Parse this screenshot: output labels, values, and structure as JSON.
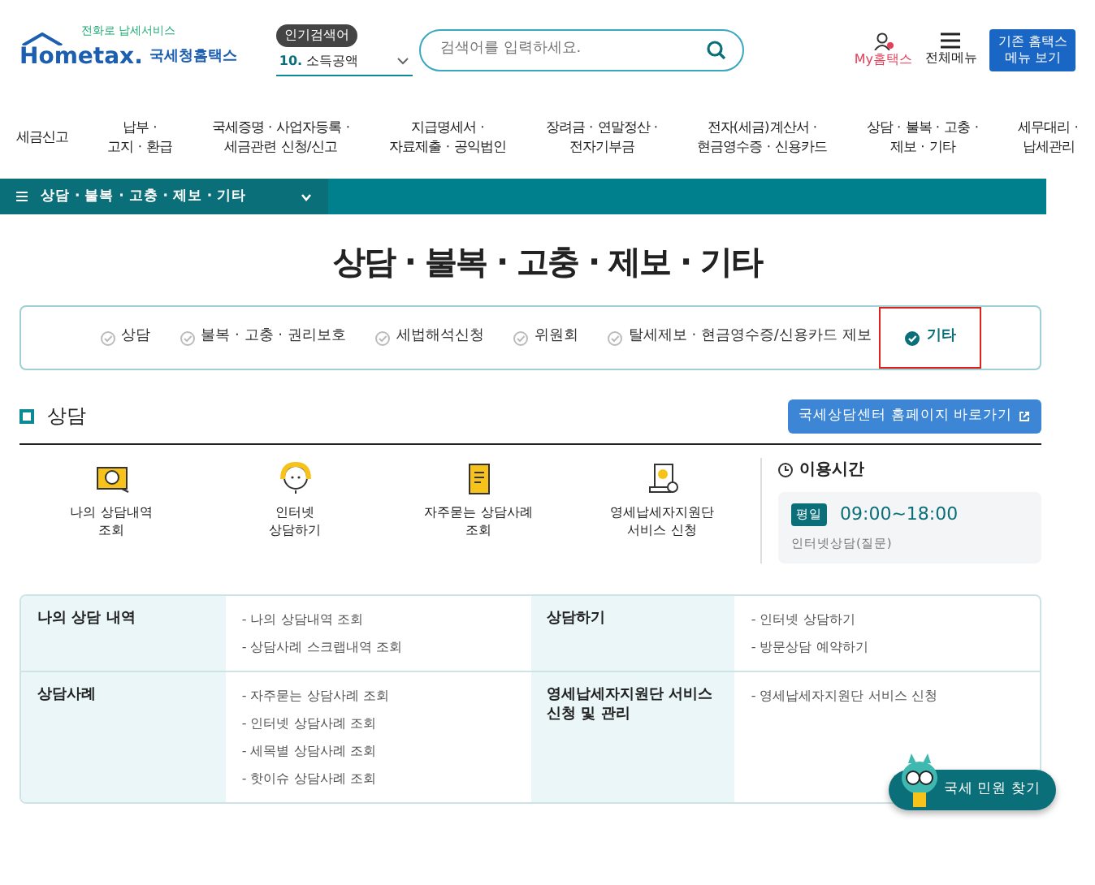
{
  "header": {
    "logo_tagline": "전화로 납세서비스",
    "logo_word": "Hometax.",
    "logo_name": "국세청홈택스",
    "popular_label": "인기검색어",
    "popular_rank": "10.",
    "popular_term": "소득공액",
    "search": {
      "placeholder": "검색어를 입력하세요."
    },
    "my_label": "My홈택스",
    "menu_label": "전체메뉴",
    "legacy_button": "기존 홈택스\n메뉴 보기"
  },
  "nav": [
    "세금신고",
    "납부 ·\n고지 · 환급",
    "국세증명 · 사업자등록 ·\n세금관련 신청/신고",
    "지급명세서 ·\n자료제출 · 공익법인",
    "장려금 · 연말정산 ·\n전자기부금",
    "전자(세금)계산서 ·\n현금영수증 · 신용카드",
    "상담 · 불복 · 고충 ·\n제보 · 기타",
    "세무대리 ·\n납세관리"
  ],
  "breadcrumb": "상담 · 불복 · 고충 · 제보 · 기타",
  "page_title": "상담 · 불복 · 고충 · 제보 · 기타",
  "tabs": [
    {
      "label": "상담",
      "selected": false,
      "highlighted": false
    },
    {
      "label": "불복 · 고충 · 권리보호",
      "selected": false,
      "highlighted": false
    },
    {
      "label": "세법해석신청",
      "selected": false,
      "highlighted": false
    },
    {
      "label": "위원회",
      "selected": false,
      "highlighted": false
    },
    {
      "label": "탈세제보 · 현금영수증/신용카드 제보",
      "selected": false,
      "highlighted": false
    },
    {
      "label": "기타",
      "selected": true,
      "highlighted": true
    }
  ],
  "section": {
    "title": "상담",
    "link_button": "국세상담센터 홈페이지 바로가기"
  },
  "services": [
    {
      "kind": "monitor",
      "label": "나의 상담내역\n조회"
    },
    {
      "kind": "headset",
      "label": "인터넷\n상담하기"
    },
    {
      "kind": "notepad",
      "label": "자주묻는 상담사례\n조회"
    },
    {
      "kind": "document",
      "label": "영세납세자지원단\n서비스 신청"
    }
  ],
  "hours": {
    "title": "이용시간",
    "day_badge": "평일",
    "time": "09:00~18:00",
    "note": "인터넷상담(질문)"
  },
  "table": [
    [
      {
        "title": "나의 상담 내역",
        "links": [
          "- 나의 상담내역 조회",
          "- 상담사례 스크랩내역 조회"
        ]
      },
      {
        "title": "상담하기",
        "links": [
          "- 인터넷 상담하기",
          "- 방문상담 예약하기"
        ]
      }
    ],
    [
      {
        "title": "상담사례",
        "links": [
          "- 자주묻는 상담사례 조회",
          "- 인터넷 상담사례 조회",
          "- 세목별 상담사례 조회",
          "- 핫이슈 상담사례 조회"
        ]
      },
      {
        "title": "영세납세자지원단 서비스\n신청 및 관리",
        "links": [
          "- 영세납세자지원단 서비스 신청"
        ]
      }
    ]
  ],
  "floating_button": "국세 민원 찾기"
}
